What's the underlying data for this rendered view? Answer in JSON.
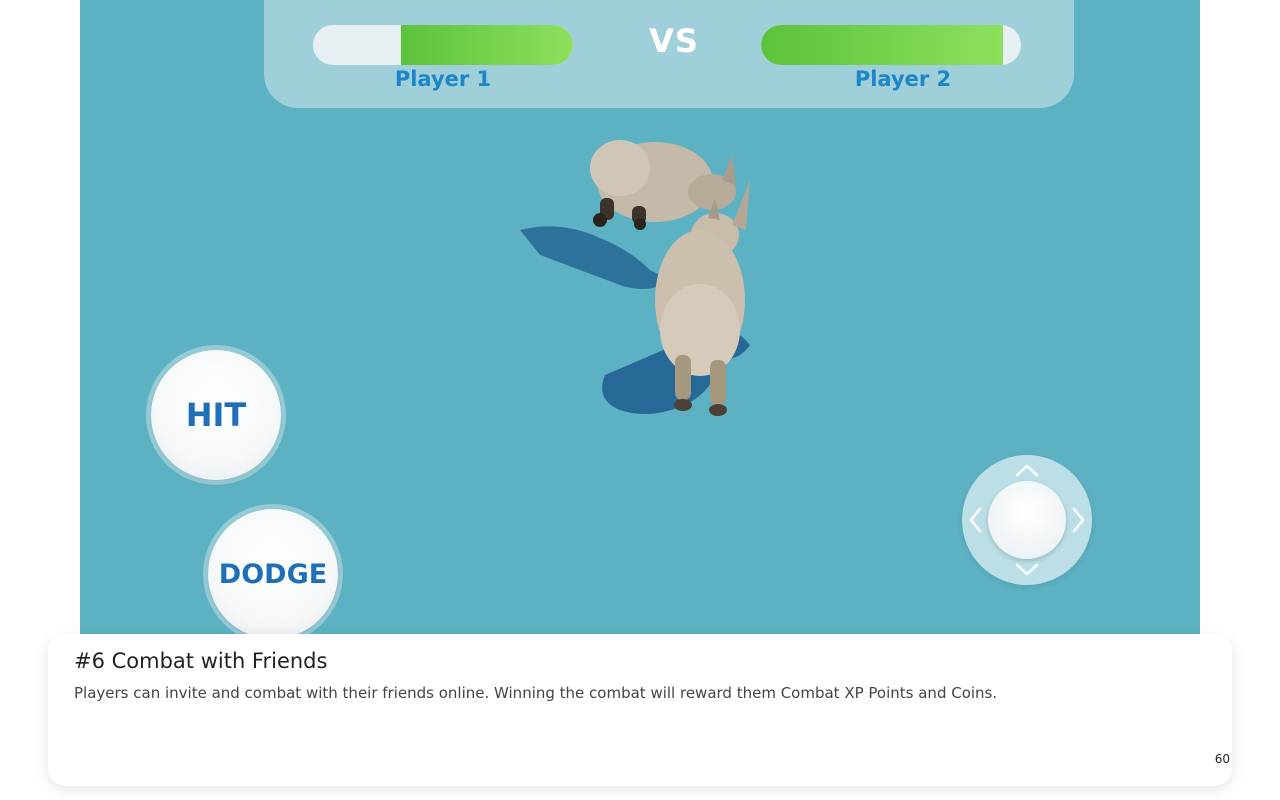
{
  "hud": {
    "vs_label": "VS",
    "player1": {
      "name": "Player 1",
      "health_fraction": 0.66
    },
    "player2": {
      "name": "Player 2",
      "health_fraction": 0.93
    },
    "health_color": "#6fd04a"
  },
  "controls": {
    "hit_label": "HIT",
    "dodge_label": "DODGE",
    "joystick_arrows": [
      "chevron-up-icon",
      "chevron-down-icon",
      "chevron-left-icon",
      "chevron-right-icon"
    ]
  },
  "scene": {
    "arena_color": "#5cb1c2",
    "characters": [
      "rhino",
      "rhino"
    ]
  },
  "caption": {
    "title": "#6 Combat with Friends",
    "description": "Players can invite and combat with their friends online. Winning the combat will reward them Combat XP Points and Coins.",
    "page_number": "60"
  }
}
